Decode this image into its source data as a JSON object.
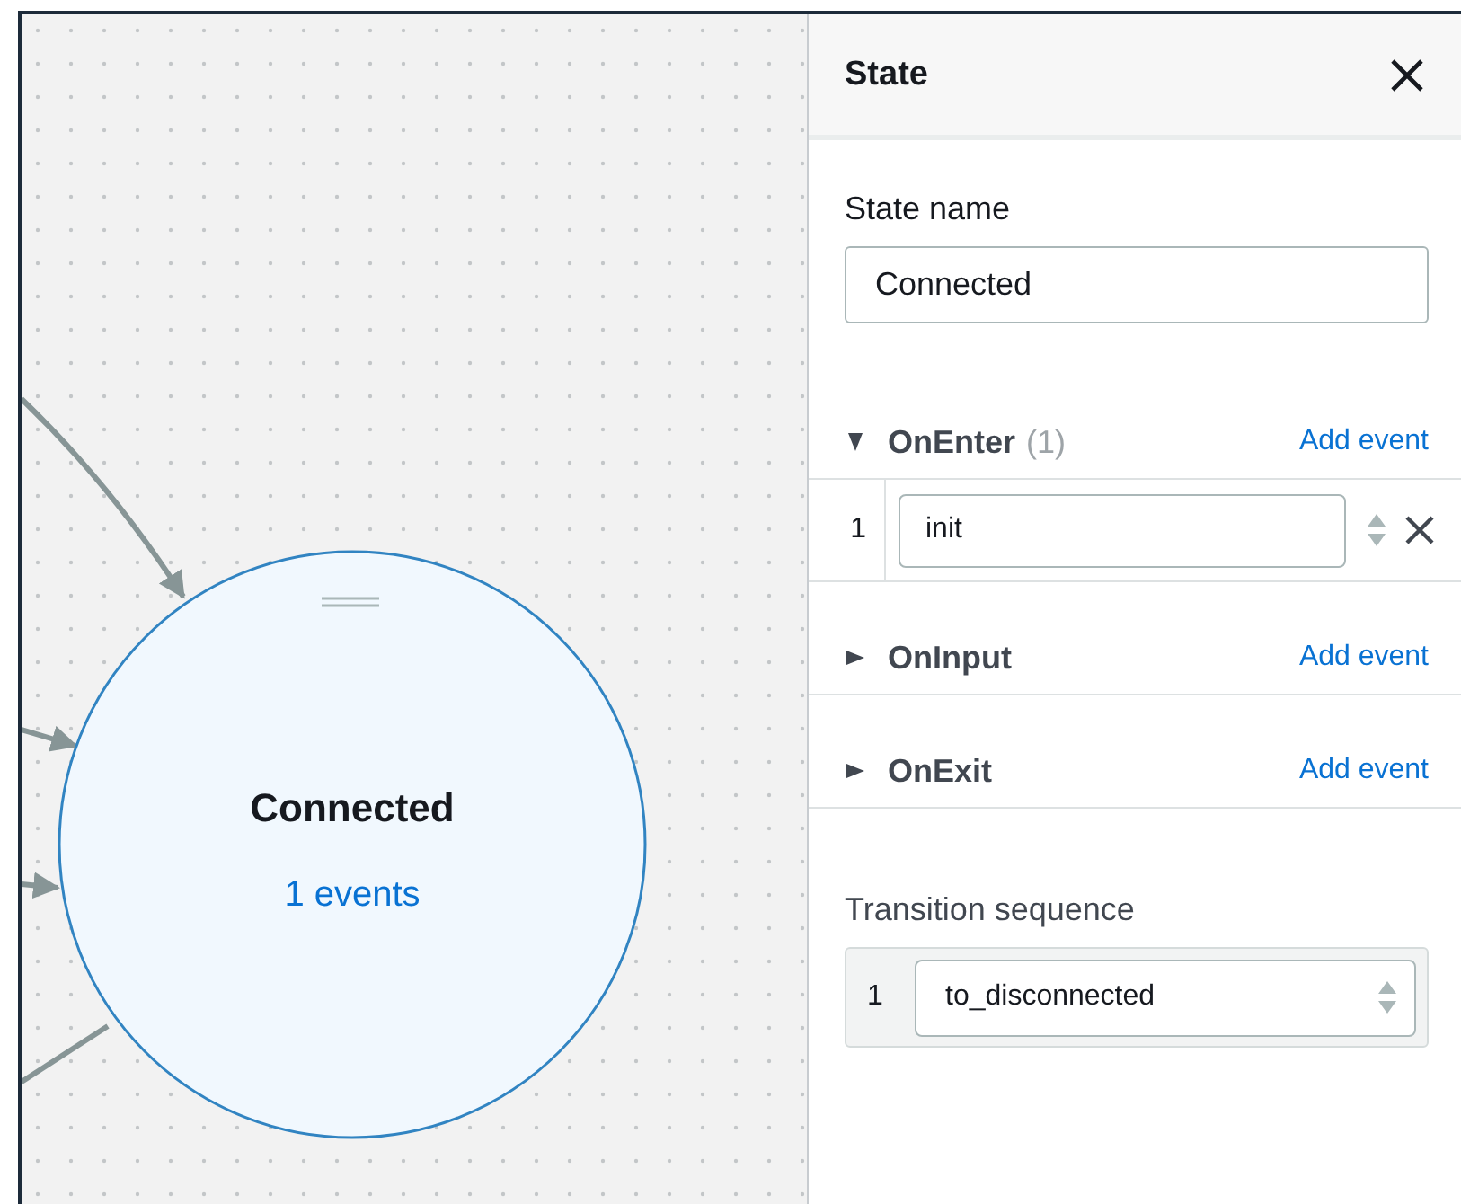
{
  "canvas": {
    "node": {
      "name": "Connected",
      "events": "1 events"
    }
  },
  "panel": {
    "title": "State",
    "field": {
      "label": "State name",
      "value": "Connected"
    },
    "sections": [
      {
        "title": "OnEnter",
        "count": "(1)",
        "expanded": true,
        "action": "Add event",
        "events": [
          {
            "index": "1",
            "value": "init"
          }
        ]
      },
      {
        "title": "OnInput",
        "expanded": false,
        "action": "Add event"
      },
      {
        "title": "OnExit",
        "expanded": false,
        "action": "Add event"
      }
    ],
    "transition": {
      "label": "Transition sequence",
      "items": [
        {
          "index": "1",
          "value": "to_disconnected"
        }
      ]
    }
  }
}
